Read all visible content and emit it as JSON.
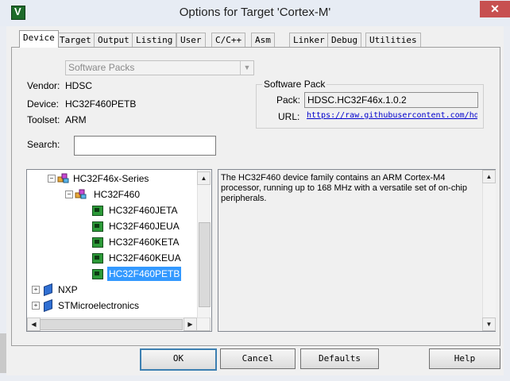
{
  "window": {
    "title": "Options for Target 'Cortex-M'",
    "close_glyph": "✕"
  },
  "tabs": [
    {
      "label": "Device",
      "active": true
    },
    {
      "label": "Target"
    },
    {
      "label": "Output"
    },
    {
      "label": "Listing"
    },
    {
      "label": "User"
    },
    {
      "label": "C/C++"
    },
    {
      "label": "Asm"
    },
    {
      "label": "Linker"
    },
    {
      "label": "Debug"
    },
    {
      "label": "Utilities"
    }
  ],
  "device": {
    "source_combo": "Software Packs",
    "vendor_label": "Vendor:",
    "vendor": "HDSC",
    "device_label": "Device:",
    "device": "HC32F460PETB",
    "toolset_label": "Toolset:",
    "toolset": "ARM",
    "search_label": "Search:",
    "search_value": ""
  },
  "software_pack": {
    "title": "Software Pack",
    "pack_label": "Pack:",
    "pack": "HDSC.HC32F46x.1.0.2",
    "url_label": "URL:",
    "url": "https://raw.githubusercontent.com/hdsc"
  },
  "tree": {
    "series": "HC32F46x-Series",
    "family": "HC32F460",
    "devices": [
      "HC32F460JETA",
      "HC32F460JEUA",
      "HC32F460KETA",
      "HC32F460KEUA",
      "HC32F460PETB"
    ],
    "selected": "HC32F460PETB",
    "vendors": [
      "NXP",
      "STMicroelectronics"
    ]
  },
  "description": "The HC32F460 device family contains an ARM Cortex-M4 processor, running up to 168 MHz with a versatile set of on-chip peripherals.",
  "buttons": {
    "ok": "OK",
    "cancel": "Cancel",
    "defaults": "Defaults",
    "help": "Help"
  },
  "colors": {
    "selection": "#3399ff",
    "link": "#0000cc",
    "chip": "#2c9a38"
  }
}
